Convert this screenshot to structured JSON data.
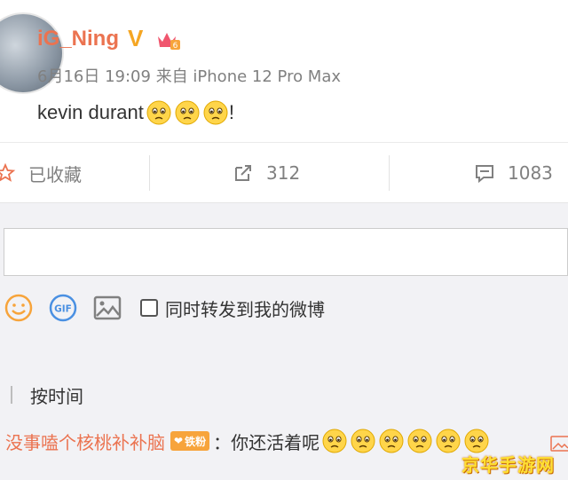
{
  "post": {
    "username": "iG_Ning",
    "verified_mark": "V",
    "timestamp": "6月16日 19:09",
    "source_prefix": "来自",
    "device": "iPhone 12 Pro Max",
    "text": "kevin durant",
    "emoji_icon": "sad-face-emoji",
    "emoji_count": 3,
    "trailing": "!"
  },
  "actions": {
    "favorite_label": "已收藏",
    "repost_count": "312",
    "comment_count": "1083"
  },
  "composer": {
    "placeholder": "",
    "sync_label": "同时转发到我的微博",
    "gif_label": "GIF"
  },
  "sort": {
    "label": "按时间"
  },
  "comments": [
    {
      "user": "没事嗑个核桃补补脑",
      "badge": "铁粉",
      "separator": "：",
      "text": "你还活着呢",
      "emoji_count": 6
    }
  ],
  "watermark": "京华手游网",
  "colors": {
    "accent": "#eb7350",
    "verified": "#f5a623",
    "badge": "#f7a43b",
    "panel_bg": "#f2f2f5"
  }
}
